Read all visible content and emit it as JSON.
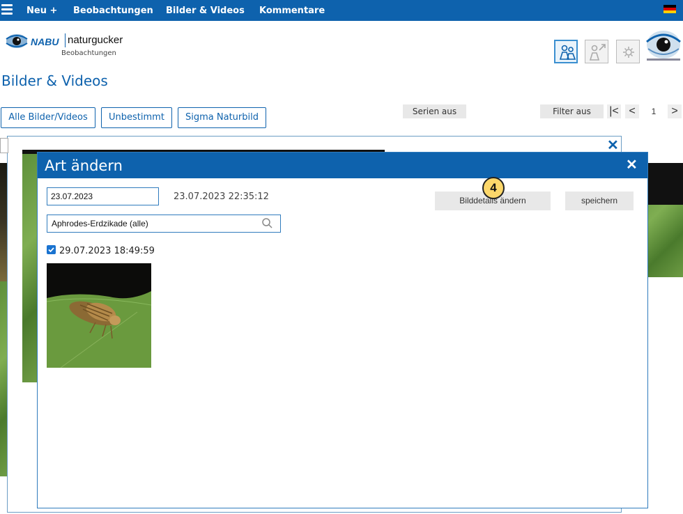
{
  "nav": {
    "items": [
      "Neu +",
      "Beobachtungen",
      "Bilder & Videos",
      "Kommentare"
    ],
    "language_icon": "german-flag-icon"
  },
  "brand": {
    "nabu": "NABU",
    "name": "naturgucker",
    "subtitle": "Beobachtungen",
    "accent_color": "#0e62ad"
  },
  "page": {
    "title": "Bilder & Videos"
  },
  "filters": {
    "buttons": [
      "Alle Bilder/Videos",
      "Unbestimmt",
      "Sigma Naturbild"
    ],
    "series": "Serien aus",
    "filter": "Filter aus",
    "pager": {
      "first": "|<",
      "prev": "<",
      "page": "1",
      "next": ">"
    }
  },
  "modal": {
    "title": "Art ändern",
    "date_value": "23.07.2023",
    "datetime": "23.07.2023 22:35:12",
    "species_value": "Aphrodes-Erdzikade (alle)",
    "checkbox_label": "29.07.2023 18:49:59",
    "checkbox_checked": true,
    "image_details_button": "Bilddetails ändern",
    "save_button": "speichern",
    "step_badge": "4"
  }
}
